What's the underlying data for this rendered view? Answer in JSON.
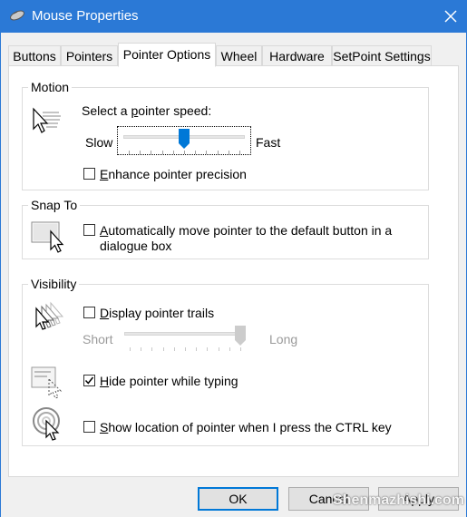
{
  "window": {
    "title": "Mouse Properties",
    "title_icon": "mouse-icon",
    "close_icon": "close-icon"
  },
  "tabs": [
    {
      "label": "Buttons",
      "active": false
    },
    {
      "label": "Pointers",
      "active": false
    },
    {
      "label": "Pointer Options",
      "active": true
    },
    {
      "label": "Wheel",
      "active": false
    },
    {
      "label": "Hardware",
      "active": false
    },
    {
      "label": "SetPoint Settings",
      "active": false
    }
  ],
  "motion": {
    "legend": "Motion",
    "speed_label_pre": "Select a ",
    "speed_label_key": "p",
    "speed_label_post": "ointer speed:",
    "slow": "Slow",
    "fast": "Fast",
    "speed_value_fraction": 0.5,
    "precision_label_key": "E",
    "precision_label_post": "nhance pointer precision",
    "precision_checked": false,
    "icon": "pointer-speed-icon"
  },
  "snap": {
    "legend": "Snap To",
    "label_key": "A",
    "label_line1_post": "utomatically move pointer to the default button in a",
    "label_line2": "dialogue box",
    "checked": false,
    "icon": "snap-to-icon"
  },
  "visibility": {
    "legend": "Visibility",
    "trails_key": "D",
    "trails_post": "isplay pointer trails",
    "trails_checked": false,
    "short": "Short",
    "long": "Long",
    "trails_value_fraction": 1.0,
    "hide_key": "H",
    "hide_post": "ide pointer while typing",
    "hide_checked": true,
    "show_key": "S",
    "show_post": "how location of pointer when I press the CTRL key",
    "show_checked": false,
    "trails_icon": "pointer-trails-icon",
    "hide_icon": "hide-pointer-icon",
    "show_icon": "pointer-location-icon"
  },
  "buttons": {
    "ok": "OK",
    "cancel": "Cancel",
    "apply": "Apply"
  },
  "watermark": "Shenmazhishi.com"
}
